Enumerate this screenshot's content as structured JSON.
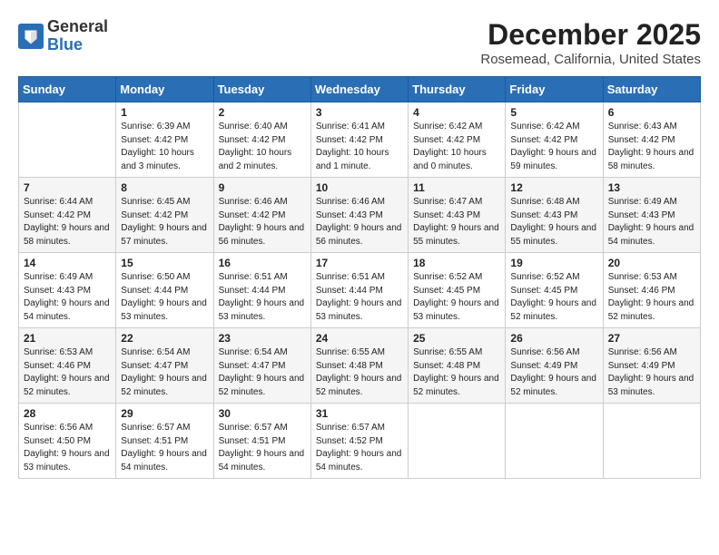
{
  "header": {
    "logo_line1": "General",
    "logo_line2": "Blue",
    "month_title": "December 2025",
    "location": "Rosemead, California, United States"
  },
  "days_of_week": [
    "Sunday",
    "Monday",
    "Tuesday",
    "Wednesday",
    "Thursday",
    "Friday",
    "Saturday"
  ],
  "weeks": [
    [
      {
        "day": "",
        "sunrise": "",
        "sunset": "",
        "daylight": ""
      },
      {
        "day": "1",
        "sunrise": "Sunrise: 6:39 AM",
        "sunset": "Sunset: 4:42 PM",
        "daylight": "Daylight: 10 hours and 3 minutes."
      },
      {
        "day": "2",
        "sunrise": "Sunrise: 6:40 AM",
        "sunset": "Sunset: 4:42 PM",
        "daylight": "Daylight: 10 hours and 2 minutes."
      },
      {
        "day": "3",
        "sunrise": "Sunrise: 6:41 AM",
        "sunset": "Sunset: 4:42 PM",
        "daylight": "Daylight: 10 hours and 1 minute."
      },
      {
        "day": "4",
        "sunrise": "Sunrise: 6:42 AM",
        "sunset": "Sunset: 4:42 PM",
        "daylight": "Daylight: 10 hours and 0 minutes."
      },
      {
        "day": "5",
        "sunrise": "Sunrise: 6:42 AM",
        "sunset": "Sunset: 4:42 PM",
        "daylight": "Daylight: 9 hours and 59 minutes."
      },
      {
        "day": "6",
        "sunrise": "Sunrise: 6:43 AM",
        "sunset": "Sunset: 4:42 PM",
        "daylight": "Daylight: 9 hours and 58 minutes."
      }
    ],
    [
      {
        "day": "7",
        "sunrise": "Sunrise: 6:44 AM",
        "sunset": "Sunset: 4:42 PM",
        "daylight": "Daylight: 9 hours and 58 minutes."
      },
      {
        "day": "8",
        "sunrise": "Sunrise: 6:45 AM",
        "sunset": "Sunset: 4:42 PM",
        "daylight": "Daylight: 9 hours and 57 minutes."
      },
      {
        "day": "9",
        "sunrise": "Sunrise: 6:46 AM",
        "sunset": "Sunset: 4:42 PM",
        "daylight": "Daylight: 9 hours and 56 minutes."
      },
      {
        "day": "10",
        "sunrise": "Sunrise: 6:46 AM",
        "sunset": "Sunset: 4:43 PM",
        "daylight": "Daylight: 9 hours and 56 minutes."
      },
      {
        "day": "11",
        "sunrise": "Sunrise: 6:47 AM",
        "sunset": "Sunset: 4:43 PM",
        "daylight": "Daylight: 9 hours and 55 minutes."
      },
      {
        "day": "12",
        "sunrise": "Sunrise: 6:48 AM",
        "sunset": "Sunset: 4:43 PM",
        "daylight": "Daylight: 9 hours and 55 minutes."
      },
      {
        "day": "13",
        "sunrise": "Sunrise: 6:49 AM",
        "sunset": "Sunset: 4:43 PM",
        "daylight": "Daylight: 9 hours and 54 minutes."
      }
    ],
    [
      {
        "day": "14",
        "sunrise": "Sunrise: 6:49 AM",
        "sunset": "Sunset: 4:43 PM",
        "daylight": "Daylight: 9 hours and 54 minutes."
      },
      {
        "day": "15",
        "sunrise": "Sunrise: 6:50 AM",
        "sunset": "Sunset: 4:44 PM",
        "daylight": "Daylight: 9 hours and 53 minutes."
      },
      {
        "day": "16",
        "sunrise": "Sunrise: 6:51 AM",
        "sunset": "Sunset: 4:44 PM",
        "daylight": "Daylight: 9 hours and 53 minutes."
      },
      {
        "day": "17",
        "sunrise": "Sunrise: 6:51 AM",
        "sunset": "Sunset: 4:44 PM",
        "daylight": "Daylight: 9 hours and 53 minutes."
      },
      {
        "day": "18",
        "sunrise": "Sunrise: 6:52 AM",
        "sunset": "Sunset: 4:45 PM",
        "daylight": "Daylight: 9 hours and 53 minutes."
      },
      {
        "day": "19",
        "sunrise": "Sunrise: 6:52 AM",
        "sunset": "Sunset: 4:45 PM",
        "daylight": "Daylight: 9 hours and 52 minutes."
      },
      {
        "day": "20",
        "sunrise": "Sunrise: 6:53 AM",
        "sunset": "Sunset: 4:46 PM",
        "daylight": "Daylight: 9 hours and 52 minutes."
      }
    ],
    [
      {
        "day": "21",
        "sunrise": "Sunrise: 6:53 AM",
        "sunset": "Sunset: 4:46 PM",
        "daylight": "Daylight: 9 hours and 52 minutes."
      },
      {
        "day": "22",
        "sunrise": "Sunrise: 6:54 AM",
        "sunset": "Sunset: 4:47 PM",
        "daylight": "Daylight: 9 hours and 52 minutes."
      },
      {
        "day": "23",
        "sunrise": "Sunrise: 6:54 AM",
        "sunset": "Sunset: 4:47 PM",
        "daylight": "Daylight: 9 hours and 52 minutes."
      },
      {
        "day": "24",
        "sunrise": "Sunrise: 6:55 AM",
        "sunset": "Sunset: 4:48 PM",
        "daylight": "Daylight: 9 hours and 52 minutes."
      },
      {
        "day": "25",
        "sunrise": "Sunrise: 6:55 AM",
        "sunset": "Sunset: 4:48 PM",
        "daylight": "Daylight: 9 hours and 52 minutes."
      },
      {
        "day": "26",
        "sunrise": "Sunrise: 6:56 AM",
        "sunset": "Sunset: 4:49 PM",
        "daylight": "Daylight: 9 hours and 52 minutes."
      },
      {
        "day": "27",
        "sunrise": "Sunrise: 6:56 AM",
        "sunset": "Sunset: 4:49 PM",
        "daylight": "Daylight: 9 hours and 53 minutes."
      }
    ],
    [
      {
        "day": "28",
        "sunrise": "Sunrise: 6:56 AM",
        "sunset": "Sunset: 4:50 PM",
        "daylight": "Daylight: 9 hours and 53 minutes."
      },
      {
        "day": "29",
        "sunrise": "Sunrise: 6:57 AM",
        "sunset": "Sunset: 4:51 PM",
        "daylight": "Daylight: 9 hours and 54 minutes."
      },
      {
        "day": "30",
        "sunrise": "Sunrise: 6:57 AM",
        "sunset": "Sunset: 4:51 PM",
        "daylight": "Daylight: 9 hours and 54 minutes."
      },
      {
        "day": "31",
        "sunrise": "Sunrise: 6:57 AM",
        "sunset": "Sunset: 4:52 PM",
        "daylight": "Daylight: 9 hours and 54 minutes."
      },
      {
        "day": "",
        "sunrise": "",
        "sunset": "",
        "daylight": ""
      },
      {
        "day": "",
        "sunrise": "",
        "sunset": "",
        "daylight": ""
      },
      {
        "day": "",
        "sunrise": "",
        "sunset": "",
        "daylight": ""
      }
    ]
  ]
}
